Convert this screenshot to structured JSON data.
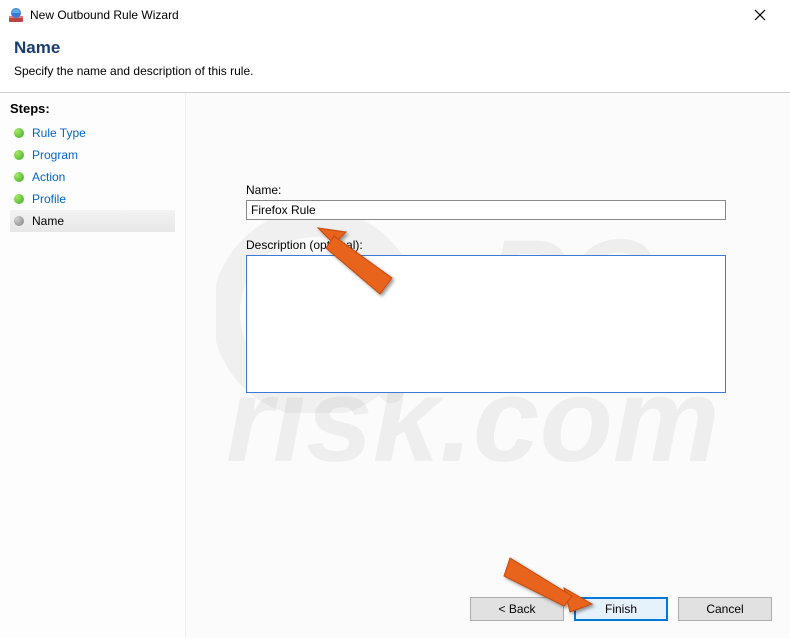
{
  "window": {
    "title": "New Outbound Rule Wizard"
  },
  "header": {
    "title": "Name",
    "subtitle": "Specify the name and description of this rule."
  },
  "sidebar": {
    "title": "Steps:",
    "items": [
      {
        "label": "Rule Type"
      },
      {
        "label": "Program"
      },
      {
        "label": "Action"
      },
      {
        "label": "Profile"
      },
      {
        "label": "Name"
      }
    ],
    "current_index": 4
  },
  "form": {
    "name_label": "Name:",
    "name_value": "Firefox Rule",
    "desc_label": "Description (optional):",
    "desc_value": ""
  },
  "buttons": {
    "back": "< Back",
    "finish": "Finish",
    "cancel": "Cancel"
  },
  "watermark": {
    "line1": "PC",
    "line2": "risk.com"
  }
}
